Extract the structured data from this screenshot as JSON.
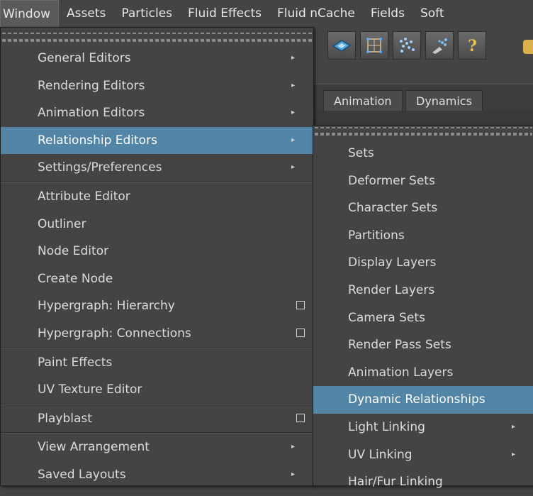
{
  "menubar": {
    "items": [
      "Window",
      "Assets",
      "Particles",
      "Fluid Effects",
      "Fluid nCache",
      "Fields",
      "Soft"
    ]
  },
  "shelf": {
    "tabs": [
      "Animation",
      "Dynamics"
    ],
    "icons": [
      "plane-icon",
      "grid-icon",
      "particles-icon",
      "emitter-icon",
      "help-icon"
    ]
  },
  "window_menu": {
    "items": [
      {
        "label": "General Editors",
        "submenu": true
      },
      {
        "label": "Rendering Editors",
        "submenu": true
      },
      {
        "label": "Animation Editors",
        "submenu": true
      },
      {
        "label": "Relationship Editors",
        "submenu": true,
        "highlighted": true
      },
      {
        "label": "Settings/Preferences",
        "submenu": true
      },
      {
        "label": "Attribute Editor"
      },
      {
        "label": "Outliner"
      },
      {
        "label": "Node Editor"
      },
      {
        "label": "Create Node"
      },
      {
        "label": "Hypergraph: Hierarchy",
        "option_box": true
      },
      {
        "label": "Hypergraph: Connections",
        "option_box": true
      },
      {
        "label": "Paint Effects"
      },
      {
        "label": "UV Texture Editor"
      },
      {
        "label": "Playblast",
        "option_box": true
      },
      {
        "label": "View Arrangement",
        "submenu": true
      },
      {
        "label": "Saved Layouts",
        "submenu": true
      }
    ]
  },
  "relationship_submenu": {
    "items": [
      {
        "label": "Sets"
      },
      {
        "label": "Deformer Sets"
      },
      {
        "label": "Character Sets"
      },
      {
        "label": "Partitions"
      },
      {
        "label": "Display Layers"
      },
      {
        "label": "Render Layers"
      },
      {
        "label": "Camera Sets"
      },
      {
        "label": "Render Pass Sets"
      },
      {
        "label": "Animation Layers"
      },
      {
        "label": "Dynamic Relationships",
        "highlighted": true
      },
      {
        "label": "Light Linking",
        "submenu": true
      },
      {
        "label": "UV Linking",
        "submenu": true
      },
      {
        "label": "Hair/Fur Linking"
      }
    ]
  },
  "colors": {
    "highlight": "#5285a6",
    "background": "#444444"
  }
}
